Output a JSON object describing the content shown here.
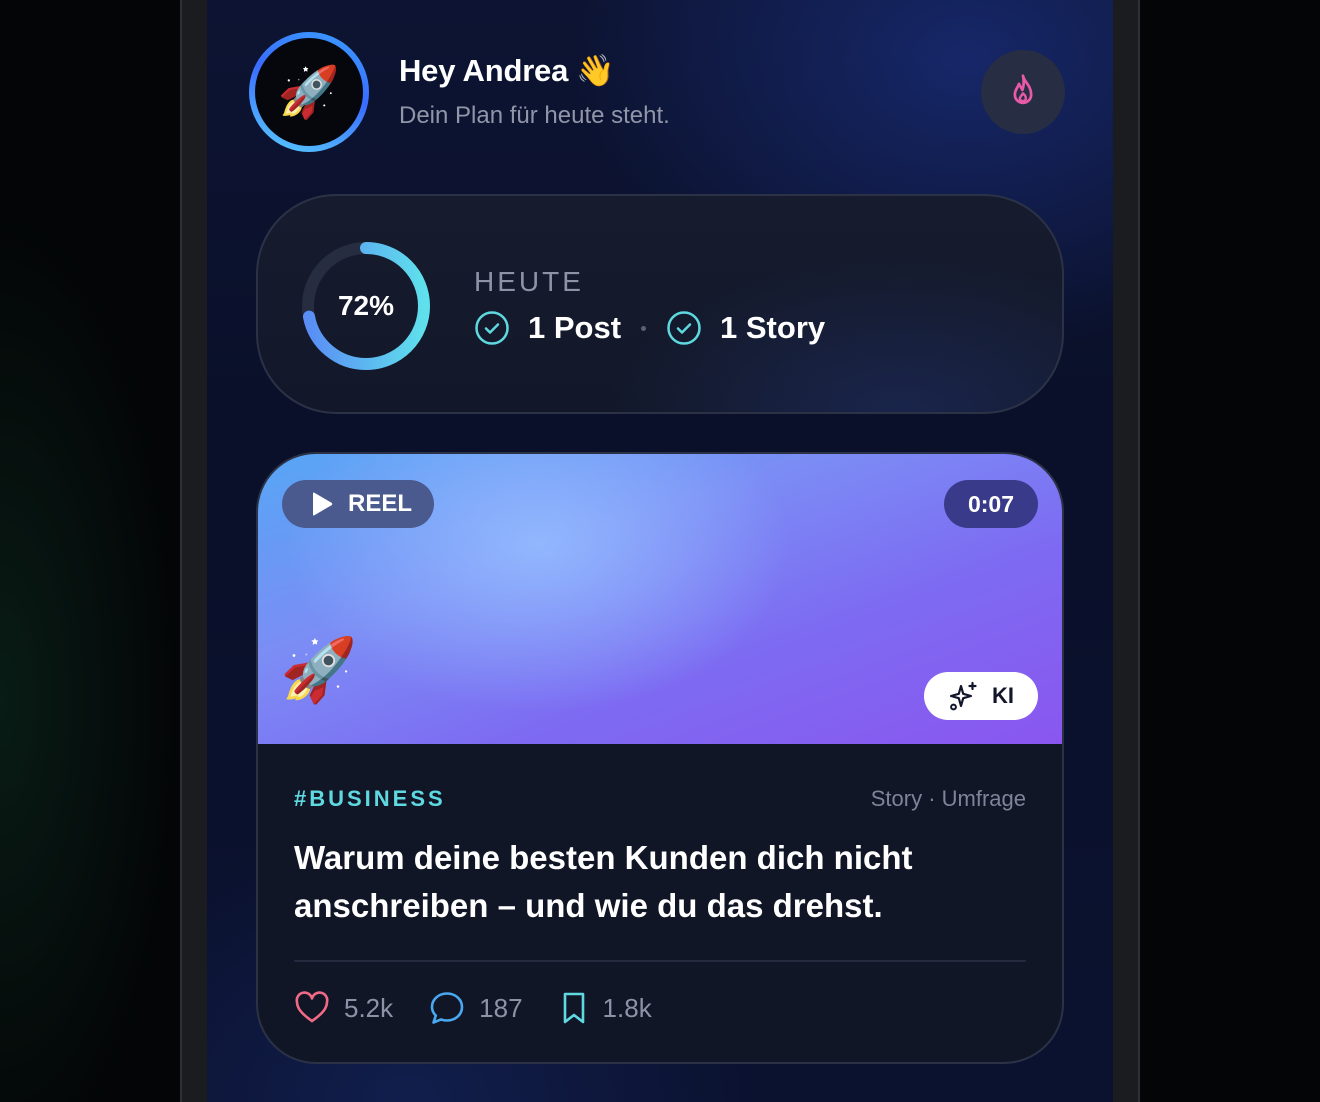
{
  "header": {
    "avatar_emoji": "🚀",
    "greeting": "Hey Andrea",
    "greeting_emoji": "👋",
    "subtitle": "Dein Plan für heute steht.",
    "streak_icon": "flame-icon"
  },
  "today": {
    "progress_percent": 72,
    "progress_label": "72%",
    "heading": "HEUTE",
    "items": [
      {
        "label": "1 Post",
        "icon": "check-circle-icon"
      },
      {
        "label": "1 Story",
        "icon": "check-circle-icon"
      }
    ],
    "separator": "·"
  },
  "reel": {
    "badge_label": "REEL",
    "duration": "0:07",
    "emoji": "🚀",
    "ai_badge_label": "KI",
    "tag": "#BUSINESS",
    "meta": "Story · Umfrage",
    "headline": "Warum deine besten Kunden dich nicht anschreiben – und wie du das drehst.",
    "stats": {
      "likes": "5.2k",
      "comments": "187",
      "saves": "1.8k"
    }
  },
  "colors": {
    "accent_cyan": "#5fd9e0",
    "accent_blue": "#5a8df5",
    "flame_pink": "#e85aa8",
    "heart": "#f06a86",
    "comment": "#4aa8f0",
    "bookmark": "#5fd9e0"
  }
}
